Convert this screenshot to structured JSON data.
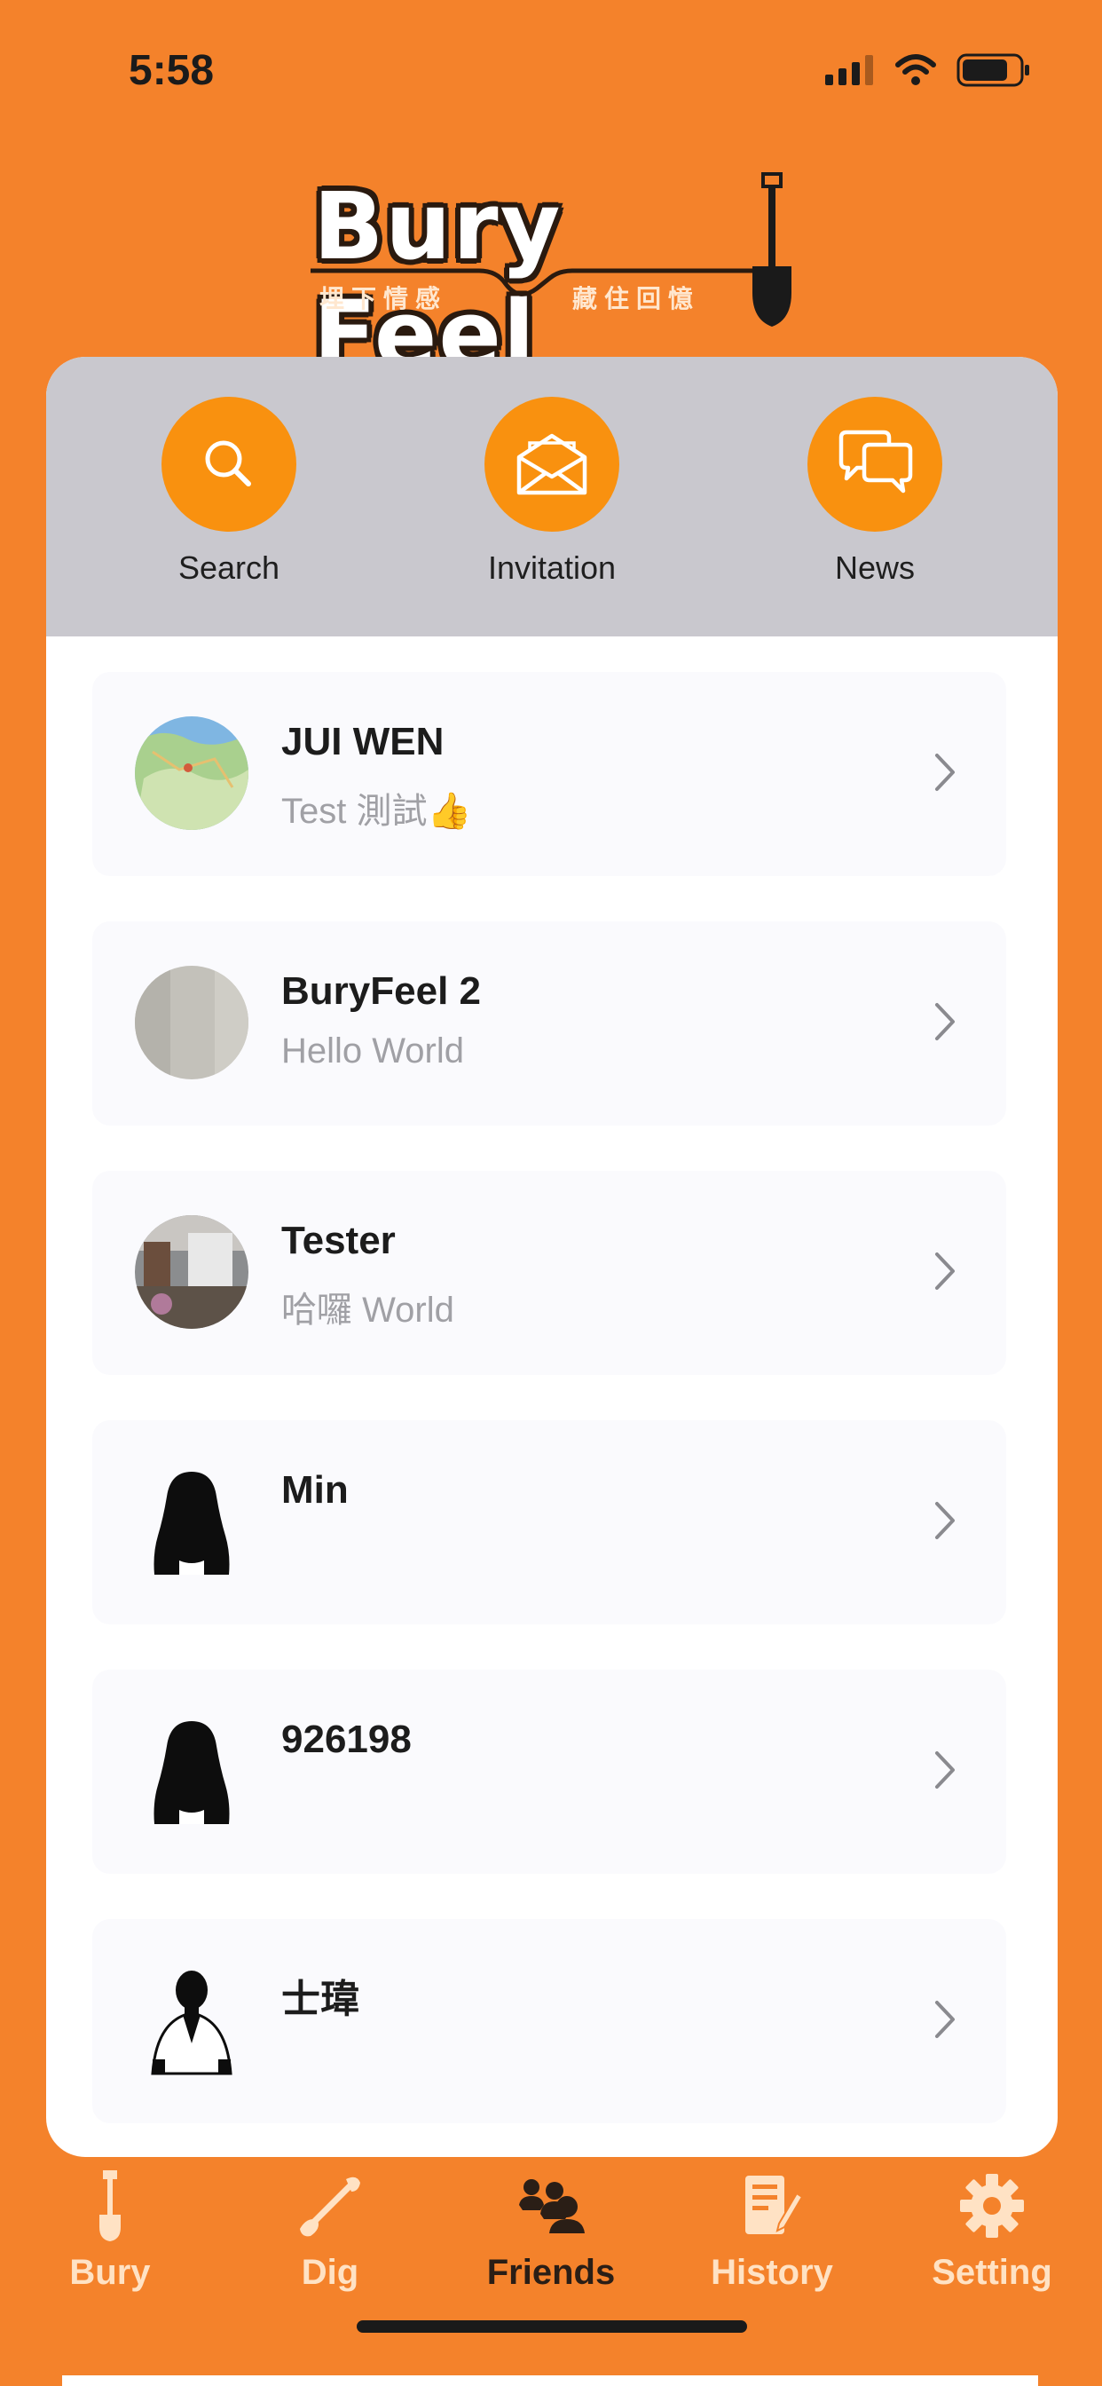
{
  "status": {
    "time": "5:58"
  },
  "logo": {
    "title": "Bury Feel",
    "subtitle_left": "埋下情感",
    "subtitle_right": "藏住回憶"
  },
  "actions": [
    {
      "label": "Search",
      "icon": "search-icon"
    },
    {
      "label": "Invitation",
      "icon": "envelope-icon"
    },
    {
      "label": "News",
      "icon": "chat-bubbles-icon"
    }
  ],
  "friends": [
    {
      "name": "JUI WEN",
      "status": "Test 測試👍",
      "avatar": "map-avatar"
    },
    {
      "name": "BuryFeel 2",
      "status": "Hello World",
      "avatar": "gray-avatar"
    },
    {
      "name": "Tester",
      "status": "哈囉 World",
      "avatar": "room-photo-avatar"
    },
    {
      "name": "Min",
      "status": "",
      "avatar": "woman-silhouette-avatar"
    },
    {
      "name": "926198",
      "status": "",
      "avatar": "woman-silhouette-avatar"
    },
    {
      "name": "士瑋",
      "status": "",
      "avatar": "man-silhouette-avatar"
    }
  ],
  "tabs": [
    {
      "label": "Bury",
      "icon": "shovel-icon",
      "active": false
    },
    {
      "label": "Dig",
      "icon": "dig-icon",
      "active": false
    },
    {
      "label": "Friends",
      "icon": "friends-icon",
      "active": true
    },
    {
      "label": "History",
      "icon": "history-icon",
      "active": false
    },
    {
      "label": "Setting",
      "icon": "gear-icon",
      "active": false
    }
  ],
  "colors": {
    "background": "#f4822b",
    "accent": "#f9910f",
    "header_gray": "#c9c8ce",
    "active_tab": "#2a1e16",
    "inactive_tab": "#ffe2c4"
  }
}
